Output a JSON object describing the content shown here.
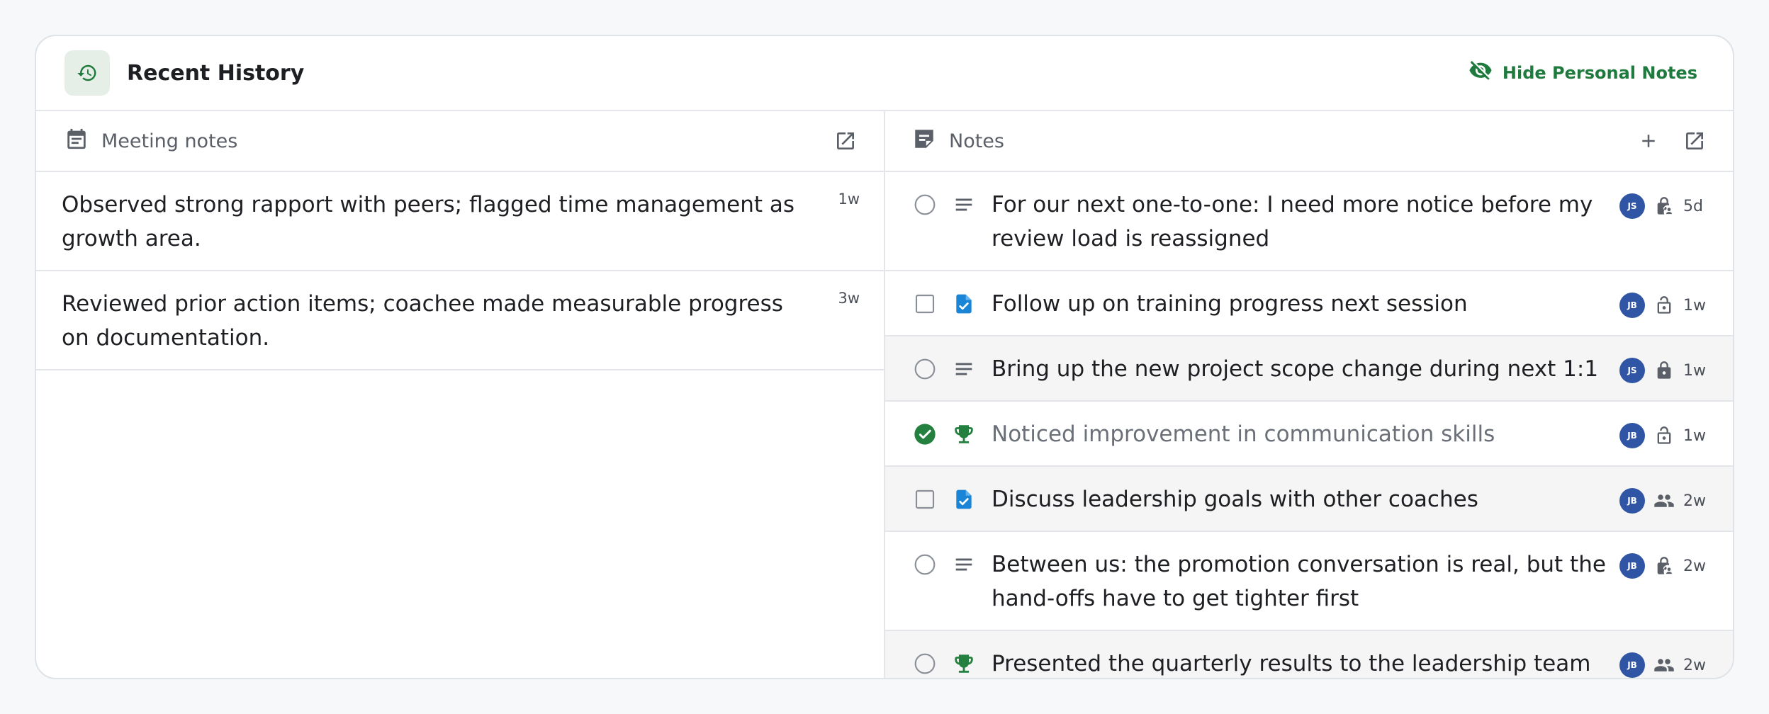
{
  "header": {
    "icon": "history-icon",
    "title": "Recent History",
    "hide_label": "Hide Personal Notes",
    "hide_icon": "eye-off-icon",
    "accent": "#1f7a3d"
  },
  "meeting_notes": {
    "title": "Meeting notes",
    "icon": "calendar-icon",
    "items": [
      {
        "text": "Observed strong rapport with peers; flagged time management as growth area.",
        "age": "1w"
      },
      {
        "text": "Reviewed prior action items; coachee made measurable progress on documentation.",
        "age": "3w"
      }
    ]
  },
  "notes": {
    "title": "Notes",
    "icon": "note-icon",
    "items": [
      {
        "status": "circle",
        "kind": "text",
        "text": "For our next one-to-one: I need more notice before my review load is reassigned",
        "initials": "JS",
        "visibility": "lock-person",
        "age": "5d",
        "done": false
      },
      {
        "status": "square",
        "kind": "task",
        "text": "Follow up on training progress next session",
        "initials": "JB",
        "visibility": "lock-open",
        "age": "1w",
        "done": false
      },
      {
        "status": "circle",
        "kind": "text",
        "text": "Bring up the new project scope change during next 1:1",
        "initials": "JS",
        "visibility": "lock",
        "age": "1w",
        "done": false
      },
      {
        "status": "checked",
        "kind": "trophy",
        "text": "Noticed improvement in communication skills",
        "initials": "JB",
        "visibility": "lock-open",
        "age": "1w",
        "done": true
      },
      {
        "status": "square",
        "kind": "task",
        "text": "Discuss leadership goals with other coaches",
        "initials": "JB",
        "visibility": "group",
        "age": "2w",
        "done": false
      },
      {
        "status": "circle",
        "kind": "text",
        "text": "Between us: the promotion conversation is real, but the hand-offs have to get tighter first",
        "initials": "JB",
        "visibility": "lock-person",
        "age": "2w",
        "done": false
      },
      {
        "status": "circle",
        "kind": "trophy",
        "text": "Presented the quarterly results to the leadership team without support",
        "initials": "JB",
        "visibility": "group",
        "age": "2w",
        "done": false
      }
    ]
  }
}
